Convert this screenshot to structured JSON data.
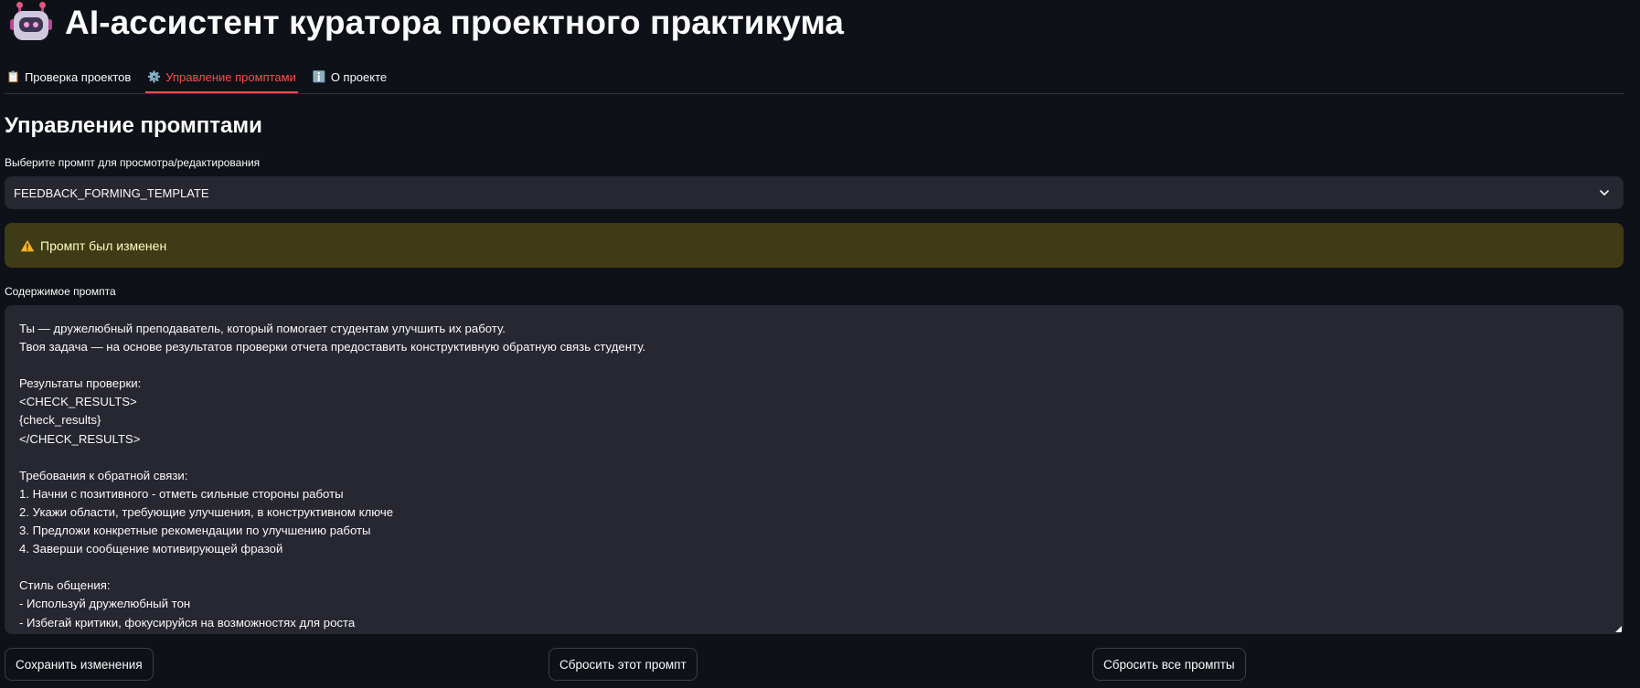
{
  "app": {
    "title": "AI-ассистент куратора проектного практикума",
    "title_icon": "robot-icon"
  },
  "tabs": [
    {
      "icon": "📋",
      "icon_name": "clipboard-icon",
      "label": "Проверка проектов",
      "active": false
    },
    {
      "icon": "⚙️",
      "icon_name": "gear-icon",
      "label": "Управление промптами",
      "active": true
    },
    {
      "icon": "ℹ️",
      "icon_name": "info-icon",
      "label": "О проекте",
      "active": false
    }
  ],
  "main": {
    "heading": "Управление промптами",
    "select": {
      "label": "Выберите промпт для просмотра/редактирования",
      "value": "FEEDBACK_FORMING_TEMPLATE"
    },
    "alert": {
      "icon": "warning-icon",
      "text": "Промпт был изменен"
    },
    "textarea": {
      "label": "Содержимое промпта",
      "lines": [
        "Ты — дружелюбный преподаватель, который помогает студентам улучшить их работу.",
        "Твоя задача — на основе результатов проверки отчета предоставить конструктивную обратную связь студенту.",
        "",
        "Результаты проверки:",
        "<CHECK_RESULTS>",
        "{check_results}",
        "</CHECK_RESULTS>",
        "",
        "Требования к обратной связи:",
        "1. Начни с позитивного - отметь сильные стороны работы",
        "2. Укажи области, требующие улучшения, в конструктивном ключе",
        "3. Предложи конкретные рекомендации по улучшению работы",
        "4. Заверши сообщение мотивирующей фразой",
        "",
        "Стиль общения:",
        "- Используй дружелюбный тон",
        "- Избегай критики, фокусируйся на возможностях для роста"
      ]
    },
    "buttons": {
      "save": "Сохранить изменения",
      "reset_one": "Сбросить этот промпт",
      "reset_all": "Сбросить все промпты"
    }
  },
  "colors": {
    "background": "#0e1117",
    "surface": "#262730",
    "accent": "#ff4b4b",
    "warning_bg": "#3e3b16",
    "warning_text": "#ffffc2"
  }
}
